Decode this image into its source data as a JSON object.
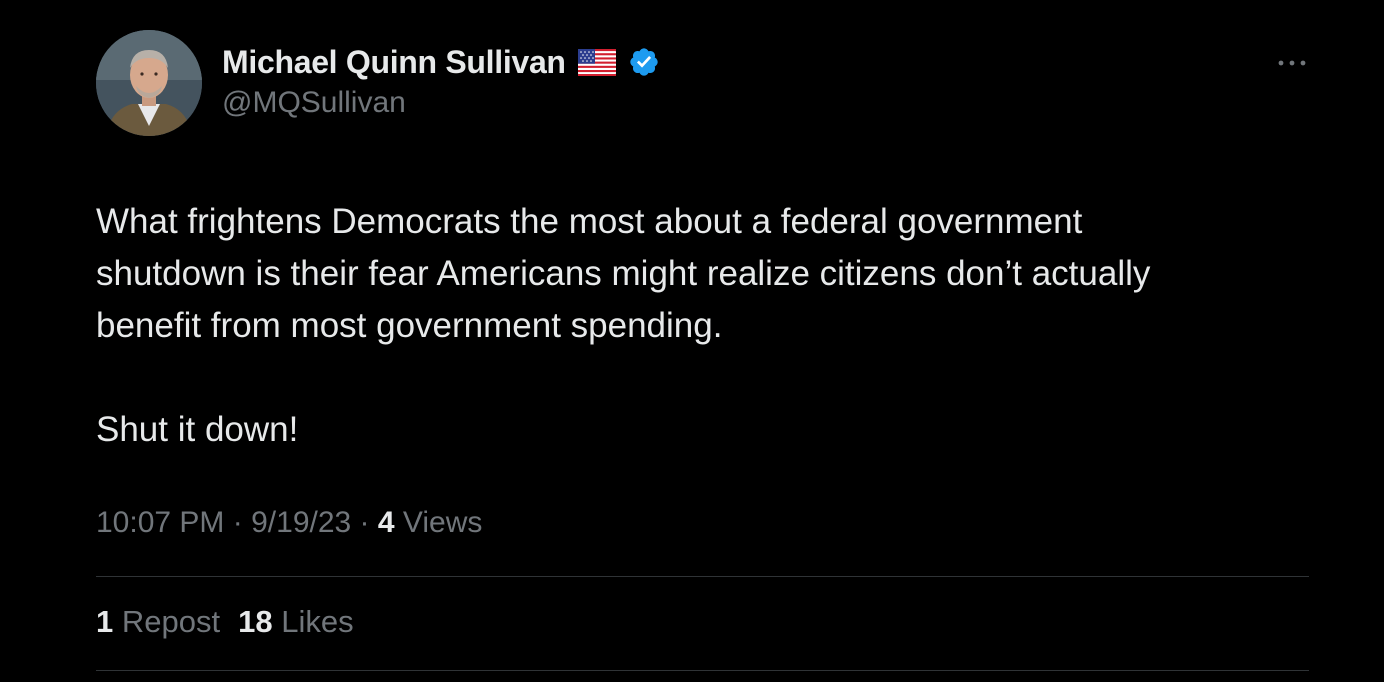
{
  "author": {
    "display_name": "Michael Quinn Sullivan",
    "handle": "@MQSullivan",
    "flag_icon": "us-flag-emoji",
    "verified_icon": "verified-badge-icon",
    "verified_color": "#1d9bf0"
  },
  "tweet": {
    "lines": [
      "What frightens Democrats the most about a federal government",
      "shutdown is their fear Americans might realize citizens don’t actually",
      "benefit from most government spending."
    ],
    "second_paragraph": "Shut it down!"
  },
  "meta": {
    "time": "10:07 PM",
    "separator": "·",
    "date": "9/19/23",
    "views_count": "4",
    "views_label": "Views"
  },
  "stats": {
    "reposts_count": "1",
    "reposts_label": "Repost",
    "likes_count": "18",
    "likes_label": "Likes"
  },
  "more_icon": "more-horizontal-icon",
  "colors": {
    "background": "#000000",
    "text_primary": "#e7e9ea",
    "text_secondary": "#71767b",
    "divider": "#2f3336"
  }
}
